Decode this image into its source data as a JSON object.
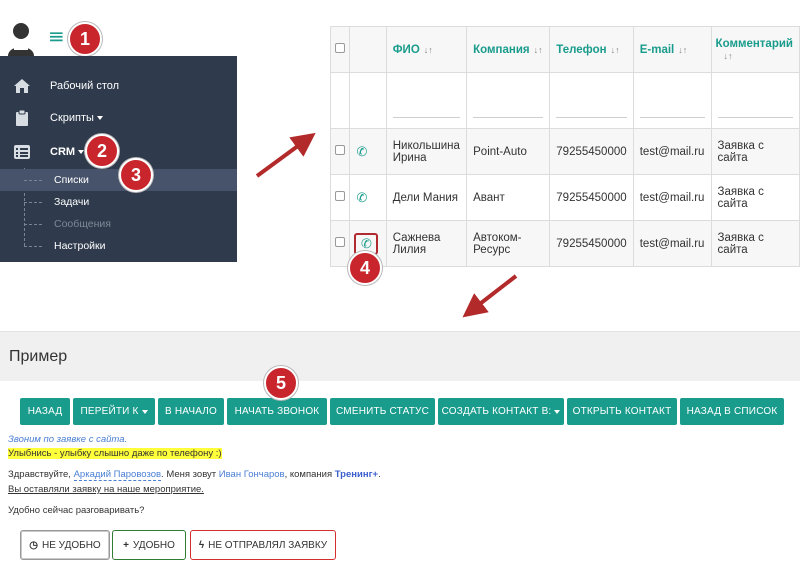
{
  "sidebar": {
    "items": [
      {
        "label": "Рабочий стол",
        "icon": "home-icon"
      },
      {
        "label": "Скрипты",
        "icon": "clipboard-icon"
      },
      {
        "label": "CRM",
        "icon": "list-icon"
      }
    ],
    "subitems": [
      {
        "label": "Списки",
        "active": true
      },
      {
        "label": "Задачи"
      },
      {
        "label": "Сообщения",
        "muted": true
      },
      {
        "label": "Настройки"
      }
    ]
  },
  "badges": [
    "1",
    "2",
    "3",
    "4",
    "5"
  ],
  "table": {
    "columns": [
      "ФИО",
      "Компания",
      "Телефон",
      "E-mail",
      "Комментарий"
    ],
    "rows": [
      {
        "name": [
          "Никольшина",
          "Ирина"
        ],
        "company": [
          "Point-Auto"
        ],
        "phone": "79255450000",
        "email": "test@mail.ru",
        "comment": "Заявка с сайта"
      },
      {
        "name": [
          "Дели Мания"
        ],
        "company": [
          "Авант"
        ],
        "phone": "79255450000",
        "email": "test@mail.ru",
        "comment": "Заявка с сайта"
      },
      {
        "name": [
          "Сажнева",
          "Лилия"
        ],
        "company": [
          "Автоком-",
          "Ресурс"
        ],
        "phone": "79255450000",
        "email": "test@mail.ru",
        "comment": "Заявка с сайта"
      }
    ]
  },
  "example": {
    "title": "Пример",
    "buttons": [
      "НАЗАД",
      "ПЕРЕЙТИ К",
      "В НАЧАЛО",
      "НАЧАТЬ ЗВОНОК",
      "СМЕНИТЬ СТАТУС",
      "СОЗДАТЬ КОНТАКТ В:",
      "ОТКРЫТЬ КОНТАКТ",
      "НАЗАД В СПИСОК"
    ],
    "note": "Звоним по заявке с сайта.",
    "highlight": "Улыбнись - улыбку слышно даже по телефону :)",
    "greeting": {
      "p1": "Здравствуйте,",
      "client": "Аркадий Паровозов",
      "p2": ". Меня зовут",
      "manager": "Иван Гончаров",
      "p3": ", компания",
      "company": "Тренинг+",
      "p4": "."
    },
    "reason": "Вы оставляли заявку на наше мероприятие.",
    "question": "Удобно сейчас разговаривать?",
    "answers": [
      "НЕ УДОБНО",
      "УДОБНО",
      "НЕ ОТПРАВЛЯЛ ЗАЯВКУ"
    ]
  },
  "colors": {
    "accent": "#1a9c8c",
    "sidebar": "#2f3b4c",
    "badge": "#c8262c",
    "highlight": "#ffff3a"
  }
}
